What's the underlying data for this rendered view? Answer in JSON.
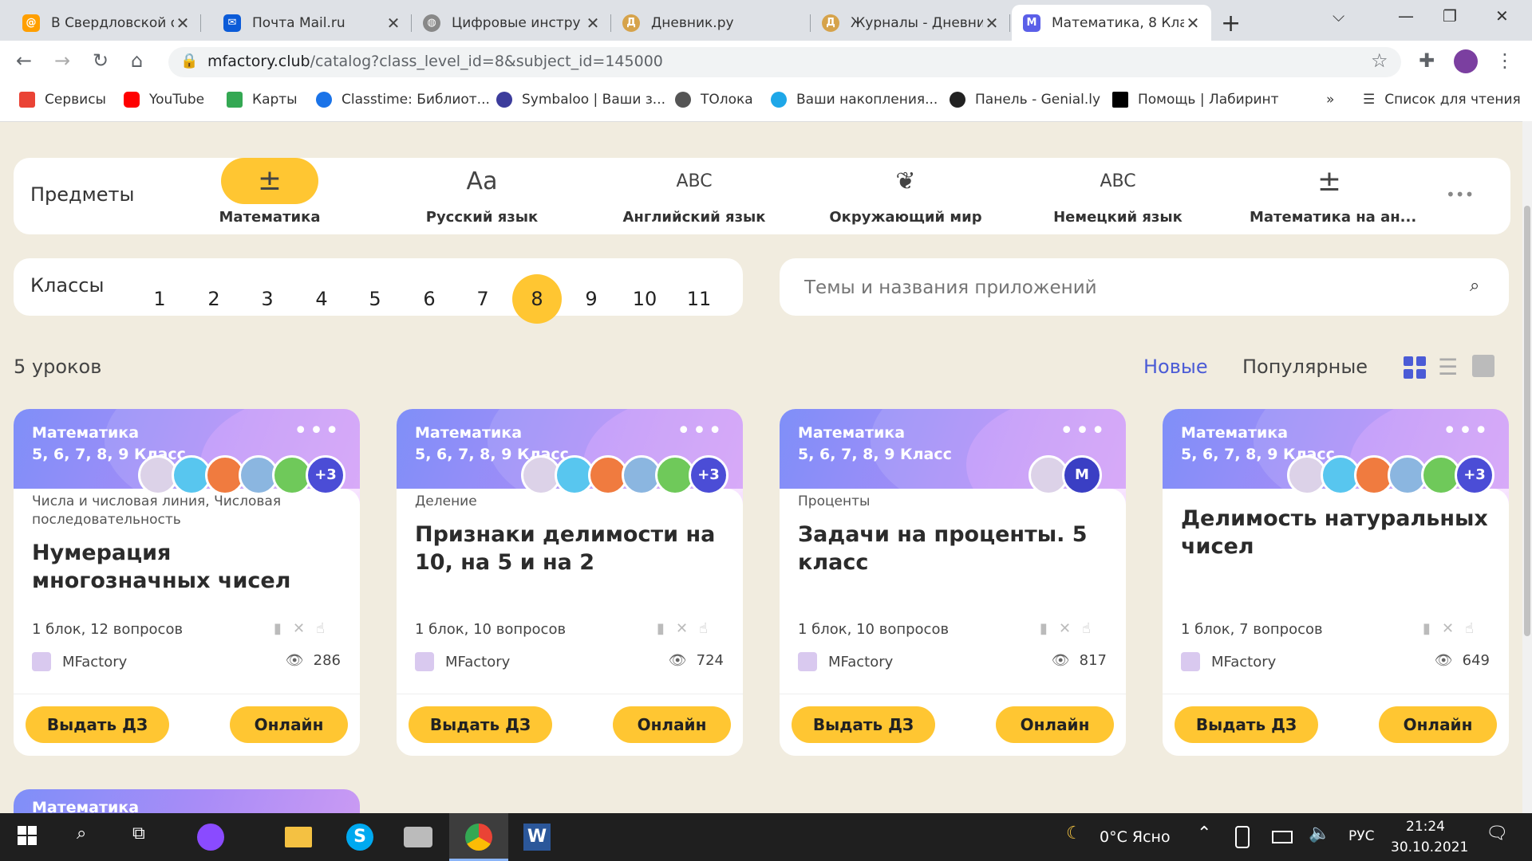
{
  "browser": {
    "tabs": [
      {
        "title": "В Свердловской об",
        "fav_color": "#ff9f00"
      },
      {
        "title": "Почта Mail.ru",
        "fav_color": "#0b5bd8"
      },
      {
        "title": "Цифровые инстру",
        "fav_color": "#666666"
      },
      {
        "title": "Дневник.ру",
        "fav_color": "#d6a34b"
      },
      {
        "title": "Журналы - Дневни",
        "fav_color": "#d6a34b"
      },
      {
        "title": "Математика, 8 Кла",
        "fav_color": "#5b5fe8"
      }
    ],
    "url_host": "mfactory.club",
    "url_path": "/catalog?class_level_id=8&subject_id=145000",
    "bookmarks": [
      {
        "label": "Сервисы",
        "color": "#ea4335"
      },
      {
        "label": "YouTube",
        "color": "#ff0000"
      },
      {
        "label": "Карты",
        "color": "#34a853"
      },
      {
        "label": "Classtime: Библиот...",
        "color": "#1a73e8"
      },
      {
        "label": "Symbaloo | Ваши з...",
        "color": "#3c3c9c"
      },
      {
        "label": "ТОлока",
        "color": "#555555"
      },
      {
        "label": "Ваши накопления...",
        "color": "#1ea7e8"
      },
      {
        "label": "Панель - Genial.ly",
        "color": "#222222"
      },
      {
        "label": "Помощь | Лабиринт",
        "color": "#000000"
      }
    ],
    "bookmarks_more": "»",
    "reading_list": "Список для чтения"
  },
  "subjects": {
    "heading": "Предметы",
    "items": [
      {
        "label": "Математика",
        "icon": "±"
      },
      {
        "label": "Русский язык",
        "icon": "Aa"
      },
      {
        "label": "Английский язык",
        "icon": "ᴬᴮᶜ"
      },
      {
        "label": "Окружающий мир",
        "icon": "❦"
      },
      {
        "label": "Немецкий язык",
        "icon": "ᴬᴮᶜ"
      },
      {
        "label": "Математика на ан...",
        "icon": "±"
      }
    ],
    "more": "•••"
  },
  "classes": {
    "heading": "Классы",
    "items": [
      "1",
      "2",
      "3",
      "4",
      "5",
      "6",
      "7",
      "8",
      "9",
      "10",
      "11"
    ],
    "selected": "8"
  },
  "search": {
    "placeholder": "Темы и названия приложений"
  },
  "results": {
    "count_label": "5 уроков",
    "sort_new": "Новые",
    "sort_popular": "Популярные"
  },
  "cards": [
    {
      "subject": "Математика",
      "grades": "5, 6, 7, 8, 9 Класс",
      "plus": "+3",
      "topic": "Числа и числовая линия, Числовая последовательность",
      "title": "Нумерация многозначных чисел",
      "meta": "1 блок, 12 вопросов",
      "author": "MFactory",
      "views": "286",
      "btn_hw": "Выдать ДЗ",
      "btn_online": "Онлайн"
    },
    {
      "subject": "Математика",
      "grades": "5, 6, 7, 8, 9 Класс",
      "plus": "+3",
      "topic": "Деление",
      "title": "Признаки делимости на 10, на 5 и на 2",
      "meta": "1 блок, 10 вопросов",
      "author": "MFactory",
      "views": "724",
      "btn_hw": "Выдать ДЗ",
      "btn_online": "Онлайн"
    },
    {
      "subject": "Математика",
      "grades": "5, 6, 7, 8, 9 Класс",
      "plus": "",
      "topic": "Проценты",
      "title": "Задачи на проценты. 5 класс",
      "meta": "1 блок, 10 вопросов",
      "author": "MFactory",
      "views": "817",
      "btn_hw": "Выдать ДЗ",
      "btn_online": "Онлайн"
    },
    {
      "subject": "Математика",
      "grades": "5, 6, 7, 8, 9 Класс",
      "plus": "+3",
      "topic": "",
      "title": "Делимость натуральных чисел",
      "meta": "1 блок, 7 вопросов",
      "author": "MFactory",
      "views": "649",
      "btn_hw": "Выдать ДЗ",
      "btn_online": "Онлайн"
    }
  ],
  "partial_card": {
    "subject": "Математика"
  },
  "taskbar": {
    "weather": "0°C  Ясно",
    "lang": "РУС",
    "time": "21:24",
    "date": "30.10.2021"
  },
  "accent": "#ffc632",
  "link_color": "#4b5bd6"
}
